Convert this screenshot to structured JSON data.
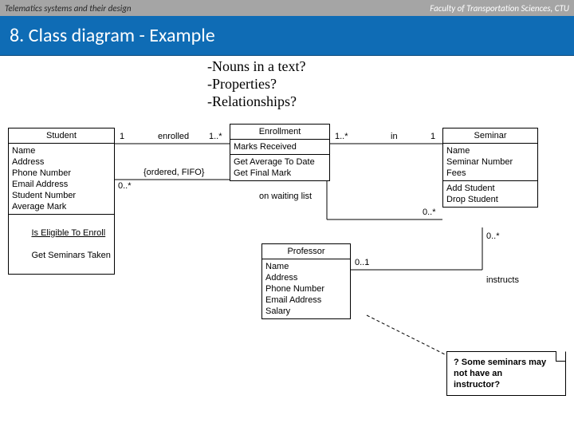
{
  "header": {
    "left": "Telematics systems and their design",
    "right": "Faculty of Transportation Sciences, CTU",
    "title": "8. Class diagram - Example"
  },
  "questions": {
    "q1": "-Nouns in a text?",
    "q2": "-Properties?",
    "q3": "-Relationships?"
  },
  "classes": {
    "student": {
      "name": "Student",
      "attrs": "Name\nAddress\nPhone Number\nEmail Address\nStudent Number\nAverage Mark",
      "op1": "Is Eligible To Enroll",
      "op2": "Get Seminars Taken"
    },
    "enrollment": {
      "name": "Enrollment",
      "attrs": "Marks Received",
      "ops": "Get Average To Date\nGet Final Mark"
    },
    "seminar": {
      "name": "Seminar",
      "attrs": "Name\nSeminar Number\nFees",
      "ops": "Add Student\nDrop Student"
    },
    "professor": {
      "name": "Professor",
      "attrs": "Name\nAddress\nPhone Number\nEmail Address\nSalary"
    }
  },
  "assoc": {
    "enrolled": {
      "name": "enrolled",
      "m1": "1",
      "m2": "1..*"
    },
    "in": {
      "name": "in",
      "m1": "1..*",
      "m2": "1"
    },
    "waiting": {
      "name": "on waiting list",
      "constraint": "{ordered, FIFO}",
      "m1": "0..*",
      "m2": "0..*"
    },
    "instructs": {
      "name": "instructs",
      "m1": "0..1",
      "m2": "0..*"
    }
  },
  "note": {
    "line1": "? Some seminars may",
    "line2": "not have an",
    "line3": "instructor?"
  }
}
